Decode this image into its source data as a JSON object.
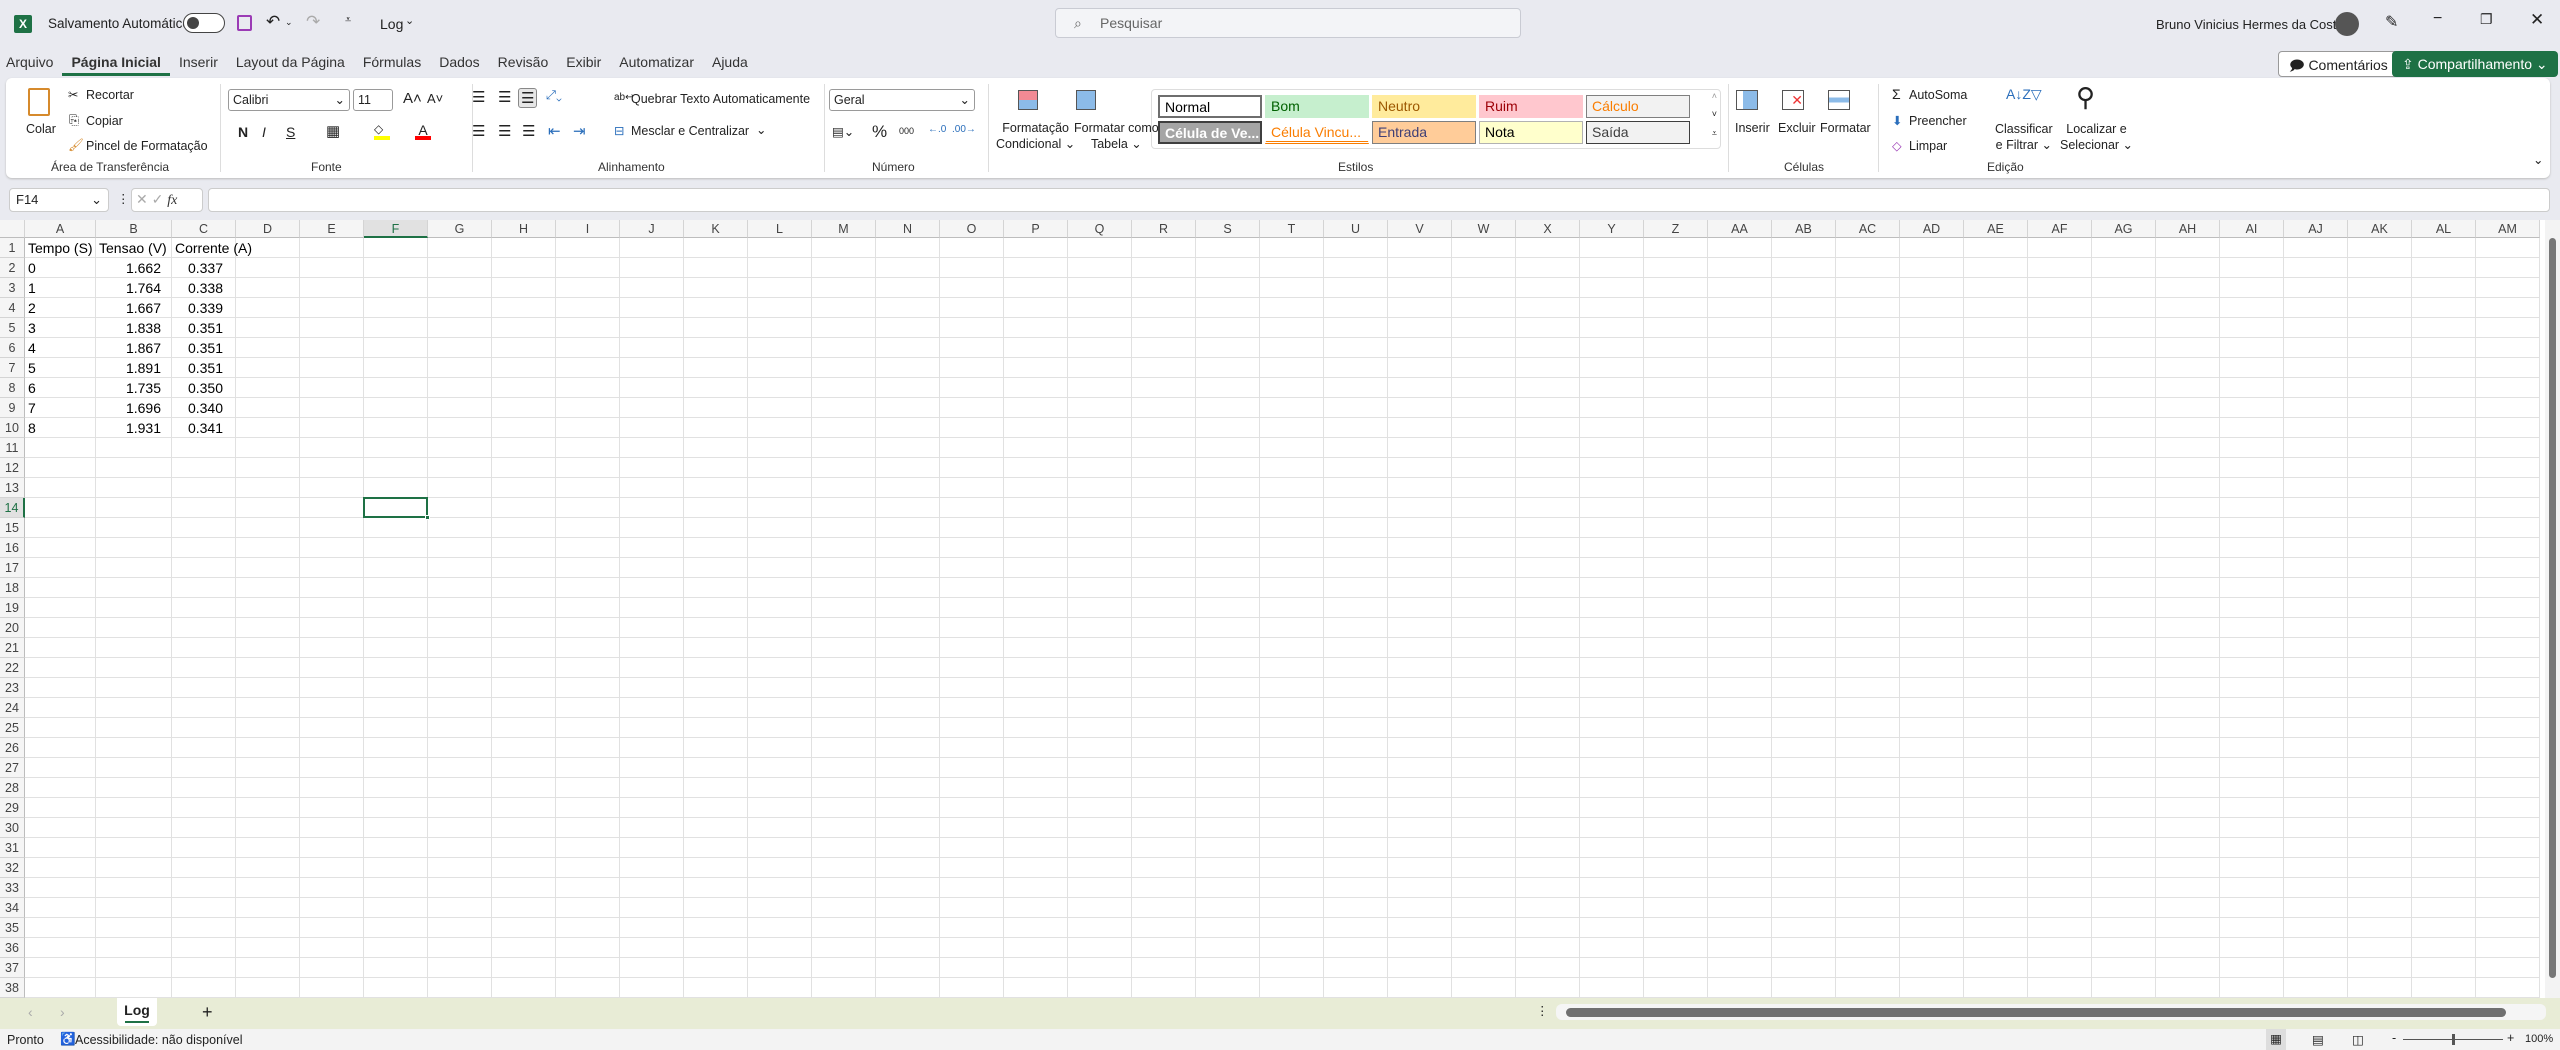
{
  "title_bar": {
    "autosave_label": "Salvamento Automático",
    "autosave_on": false,
    "doc_name": "Log",
    "search_placeholder": "Pesquisar",
    "user_name": "Bruno Vinicius Hermes da Costa"
  },
  "menu_tabs": [
    {
      "label": "Arquivo"
    },
    {
      "label": "Página Inicial",
      "active": true
    },
    {
      "label": "Inserir"
    },
    {
      "label": "Layout da Página"
    },
    {
      "label": "Fórmulas"
    },
    {
      "label": "Dados"
    },
    {
      "label": "Revisão"
    },
    {
      "label": "Exibir"
    },
    {
      "label": "Automatizar"
    },
    {
      "label": "Ajuda"
    }
  ],
  "actions": {
    "comments": "Comentários",
    "share": "Compartilhamento",
    "share_color": "#1e7145"
  },
  "ribbon": {
    "clipboard": {
      "label": "Área de Transferência",
      "paste": "Colar",
      "cut": "Recortar",
      "copy": "Copiar",
      "format_painter": "Pincel de Formatação"
    },
    "font": {
      "label": "Fonte",
      "font_name": "Calibri",
      "font_size": "11",
      "bold": "N",
      "italic": "I",
      "underline": "S",
      "highlight_color": "#ffff00",
      "font_color": "#ff0000"
    },
    "alignment": {
      "label": "Alinhamento",
      "wrap": "Quebrar Texto Automaticamente",
      "merge": "Mesclar e Centralizar"
    },
    "number": {
      "label": "Número",
      "format": "Geral",
      "percent": "%",
      "thousands": "000"
    },
    "styles": {
      "label": "Estilos",
      "conditional": [
        "Formatação",
        "Condicional"
      ],
      "as_table": [
        "Formatar como",
        "Tabela"
      ],
      "items": [
        {
          "label": "Normal",
          "bg": "#ffffff",
          "fg": "#000000",
          "border": "#6e6e6e"
        },
        {
          "label": "Bom",
          "bg": "#c6efce",
          "fg": "#006100",
          "border": "#c6efce"
        },
        {
          "label": "Neutro",
          "bg": "#ffeb9c",
          "fg": "#9c5700",
          "border": "#ffeb9c"
        },
        {
          "label": "Ruim",
          "bg": "#ffc7ce",
          "fg": "#9c0006",
          "border": "#ffc7ce"
        },
        {
          "label": "Cálculo",
          "bg": "#f2f2f2",
          "fg": "#fa7d00",
          "border": "#7f7f7f"
        },
        {
          "label": "Célula de Ve...",
          "bg": "#a5a5a5",
          "fg": "#ffffff",
          "border": "#3f3f3f"
        },
        {
          "label": "Célula Vincu...",
          "bg": "#ffffff",
          "fg": "#fa7d00",
          "border": "#ffffff"
        },
        {
          "label": "Entrada",
          "bg": "#ffcc99",
          "fg": "#3f3f76",
          "border": "#7f7f7f"
        },
        {
          "label": "Nota",
          "bg": "#ffffcc",
          "fg": "#000000",
          "border": "#b2b2b2"
        },
        {
          "label": "Saída",
          "bg": "#f2f2f2",
          "fg": "#3f3f3f",
          "border": "#3f3f3f"
        }
      ]
    },
    "cells": {
      "label": "Células",
      "insert": "Inserir",
      "delete": "Excluir",
      "format": "Formatar"
    },
    "editing": {
      "label": "Edição",
      "autosum": "AutoSoma",
      "fill": "Preencher",
      "clear": "Limpar",
      "sort": [
        "Classificar",
        "e Filtrar"
      ],
      "find": [
        "Localizar e",
        "Selecionar"
      ]
    }
  },
  "formula_bar": {
    "name_box": "F14",
    "fx": "fx",
    "value": ""
  },
  "sheet": {
    "columns": [
      "A",
      "B",
      "C",
      "D",
      "E",
      "F",
      "G",
      "H",
      "I",
      "J",
      "K",
      "L",
      "M",
      "N",
      "O",
      "P",
      "Q",
      "R",
      "S",
      "T",
      "U",
      "V",
      "W",
      "X",
      "Y",
      "Z",
      "AA",
      "AB",
      "AC",
      "AD",
      "AE",
      "AF",
      "AG",
      "AH",
      "AI",
      "AJ",
      "AK",
      "AL",
      "AM"
    ],
    "rows": [
      "1",
      "2",
      "3",
      "4",
      "5",
      "6",
      "7",
      "8",
      "9",
      "10",
      "11",
      "12",
      "13",
      "14",
      "15",
      "16",
      "17",
      "18",
      "19",
      "20",
      "21",
      "22",
      "23",
      "24",
      "25",
      "26",
      "27",
      "28",
      "29",
      "30",
      "31",
      "32",
      "33",
      "34",
      "35",
      "36",
      "37",
      "38"
    ],
    "selected": "F14",
    "headers": [
      "Tempo (S)",
      "Tensao (V)",
      "Corrente (A)"
    ],
    "data": [
      [
        "0",
        "1.662",
        "0.337"
      ],
      [
        "1",
        "1.764",
        "0.338"
      ],
      [
        "2",
        "1.667",
        "0.339"
      ],
      [
        "3",
        "1.838",
        "0.351"
      ],
      [
        "4",
        "1.867",
        "0.351"
      ],
      [
        "5",
        "1.891",
        "0.351"
      ],
      [
        "6",
        "1.735",
        "0.350"
      ],
      [
        "7",
        "1.696",
        "0.340"
      ],
      [
        "8",
        "1.931",
        "0.341"
      ]
    ]
  },
  "sheet_tabs": [
    {
      "label": "Log",
      "active": true
    }
  ],
  "status_bar": {
    "ready": "Pronto",
    "accessibility": "Acessibilidade: não disponível",
    "zoom": "100%",
    "zoom_level": 100
  }
}
